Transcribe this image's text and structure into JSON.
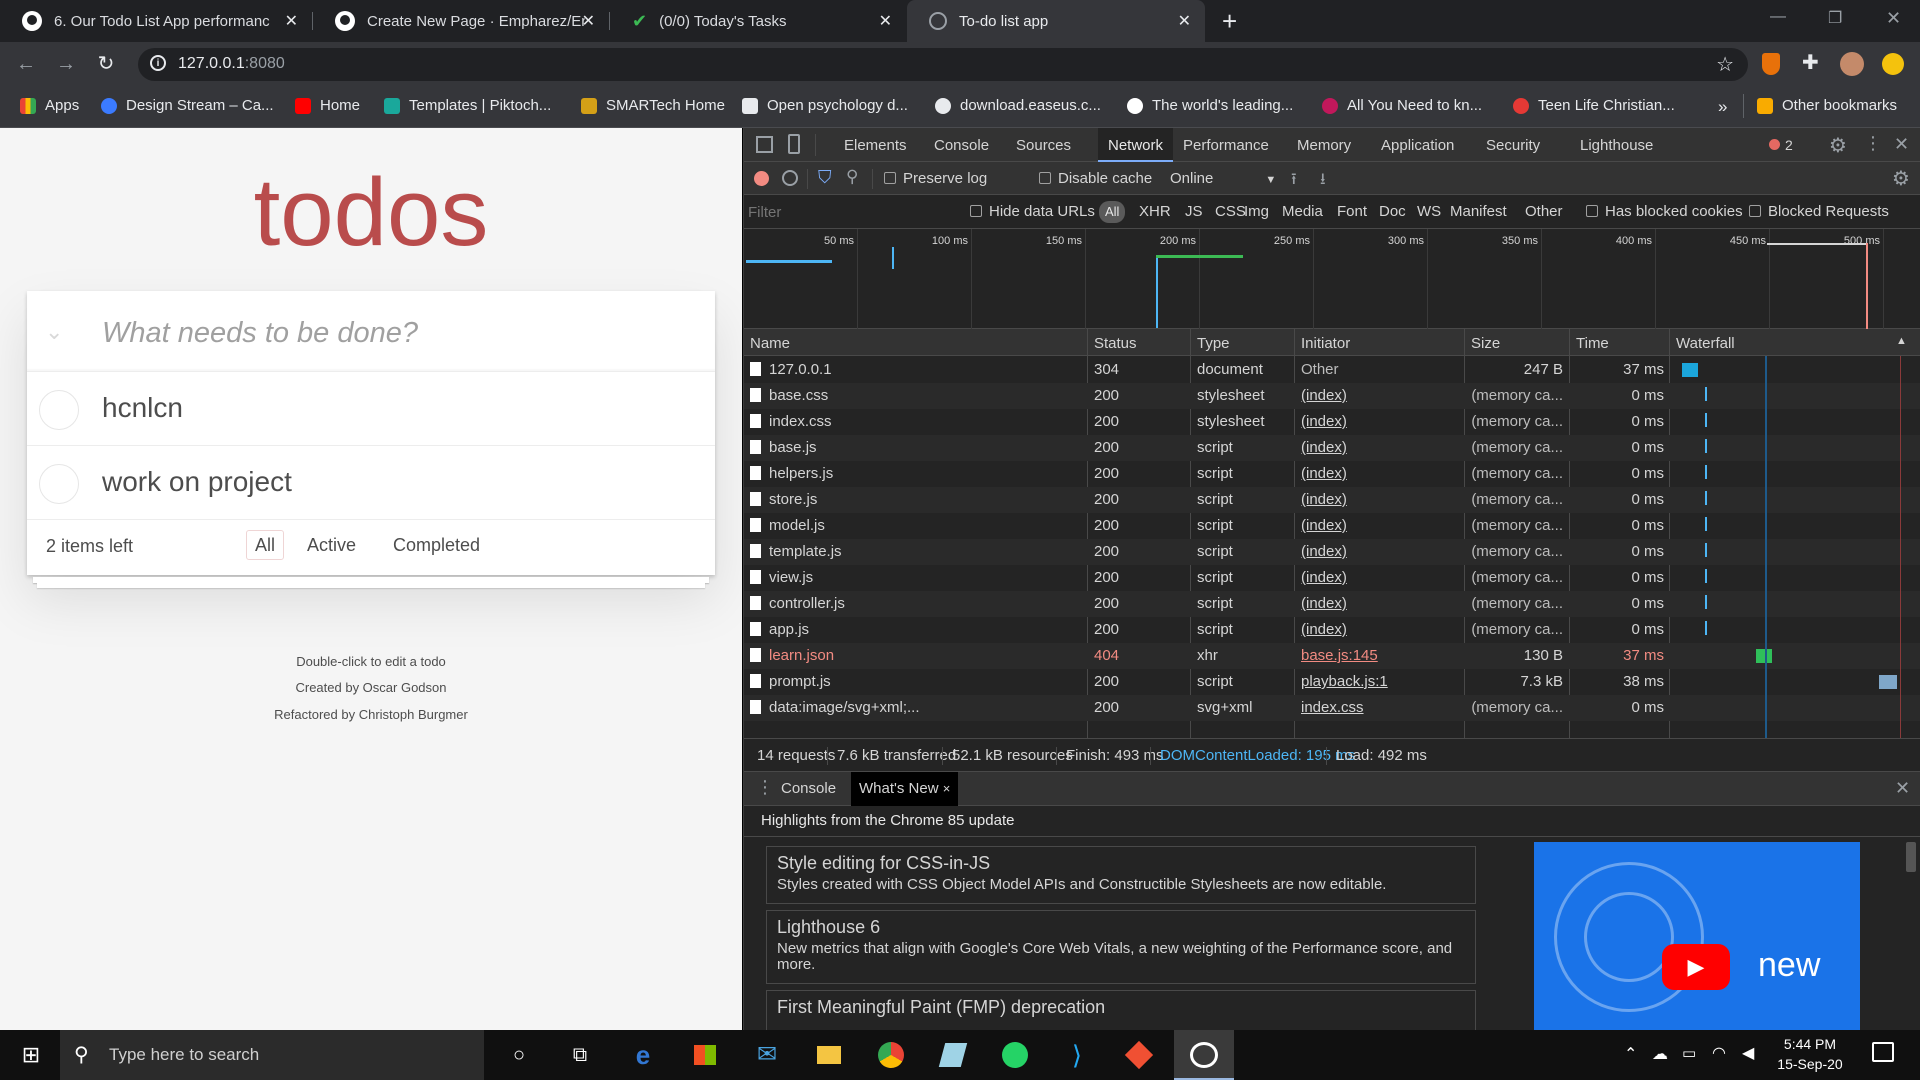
{
  "browser": {
    "tabs": [
      {
        "title": "6. Our Todo List App performanc",
        "icon": "github-icon"
      },
      {
        "title": "Create New Page · Empharez/Enh",
        "icon": "github-icon"
      },
      {
        "title": "(0/0) Today's Tasks",
        "icon": "check-icon"
      },
      {
        "title": "To-do list app",
        "icon": "globe-icon"
      }
    ],
    "new_tab": "+",
    "url_host": "127.0.0.1",
    "url_port": ":8080",
    "bookmarks": [
      "Apps",
      "Design Stream – Ca...",
      "Home",
      "Templates | Piktoch...",
      "SMARTech Home",
      "Open psychology d...",
      "download.easeus.c...",
      "The world's leading...",
      "All You Need to kn...",
      "Teen Life Christian..."
    ],
    "bookmarks_more": "»",
    "other_bookmarks": "Other bookmarks"
  },
  "todo": {
    "title": "todos",
    "placeholder": "What needs to be done?",
    "items": [
      "hcnlcn",
      "work on project"
    ],
    "items_left": "2 items left",
    "filters": [
      "All",
      "Active",
      "Completed"
    ],
    "info": [
      "Double-click to edit a todo",
      "Created by Oscar Godson",
      "Refactored by Christoph Burgmer"
    ]
  },
  "devtools": {
    "tabs": [
      "Elements",
      "Console",
      "Sources",
      "Network",
      "Performance",
      "Memory",
      "Application",
      "Security",
      "Lighthouse"
    ],
    "error_count": "2",
    "toolbar": {
      "preserve_log": "Preserve log",
      "disable_cache": "Disable cache",
      "throttle": "Online"
    },
    "filter": {
      "placeholder": "Filter",
      "hide_data_urls": "Hide data URLs",
      "types": [
        "All",
        "XHR",
        "JS",
        "CSS",
        "Img",
        "Media",
        "Font",
        "Doc",
        "WS",
        "Manifest",
        "Other"
      ],
      "has_blocked_cookies": "Has blocked cookies",
      "blocked_requests": "Blocked Requests"
    },
    "overview_ticks": [
      "50 ms",
      "100 ms",
      "150 ms",
      "200 ms",
      "250 ms",
      "300 ms",
      "350 ms",
      "400 ms",
      "450 ms",
      "500 ms"
    ],
    "columns": [
      "Name",
      "Status",
      "Type",
      "Initiator",
      "Size",
      "Time",
      "Waterfall"
    ],
    "requests": [
      {
        "name": "127.0.0.1",
        "status": "304",
        "type": "document",
        "initiator": "Other",
        "size": "247 B",
        "time": "37 ms",
        "error": false,
        "link": false
      },
      {
        "name": "base.css",
        "status": "200",
        "type": "stylesheet",
        "initiator": "(index)",
        "size": "(memory ca...",
        "time": "0 ms",
        "error": false,
        "link": true
      },
      {
        "name": "index.css",
        "status": "200",
        "type": "stylesheet",
        "initiator": "(index)",
        "size": "(memory ca...",
        "time": "0 ms",
        "error": false,
        "link": true
      },
      {
        "name": "base.js",
        "status": "200",
        "type": "script",
        "initiator": "(index)",
        "size": "(memory ca...",
        "time": "0 ms",
        "error": false,
        "link": true
      },
      {
        "name": "helpers.js",
        "status": "200",
        "type": "script",
        "initiator": "(index)",
        "size": "(memory ca...",
        "time": "0 ms",
        "error": false,
        "link": true
      },
      {
        "name": "store.js",
        "status": "200",
        "type": "script",
        "initiator": "(index)",
        "size": "(memory ca...",
        "time": "0 ms",
        "error": false,
        "link": true
      },
      {
        "name": "model.js",
        "status": "200",
        "type": "script",
        "initiator": "(index)",
        "size": "(memory ca...",
        "time": "0 ms",
        "error": false,
        "link": true
      },
      {
        "name": "template.js",
        "status": "200",
        "type": "script",
        "initiator": "(index)",
        "size": "(memory ca...",
        "time": "0 ms",
        "error": false,
        "link": true
      },
      {
        "name": "view.js",
        "status": "200",
        "type": "script",
        "initiator": "(index)",
        "size": "(memory ca...",
        "time": "0 ms",
        "error": false,
        "link": true
      },
      {
        "name": "controller.js",
        "status": "200",
        "type": "script",
        "initiator": "(index)",
        "size": "(memory ca...",
        "time": "0 ms",
        "error": false,
        "link": true
      },
      {
        "name": "app.js",
        "status": "200",
        "type": "script",
        "initiator": "(index)",
        "size": "(memory ca...",
        "time": "0 ms",
        "error": false,
        "link": true
      },
      {
        "name": "learn.json",
        "status": "404",
        "type": "xhr",
        "initiator": "base.js:145",
        "size": "130 B",
        "time": "37 ms",
        "error": true,
        "link": true
      },
      {
        "name": "prompt.js",
        "status": "200",
        "type": "script",
        "initiator": "playback.js:1",
        "size": "7.3 kB",
        "time": "38 ms",
        "error": false,
        "link": true
      },
      {
        "name": "data:image/svg+xml;...",
        "status": "200",
        "type": "svg+xml",
        "initiator": "index.css",
        "size": "(memory ca...",
        "time": "0 ms",
        "error": false,
        "link": true
      }
    ],
    "summary": {
      "requests": "14 requests",
      "transferred": "7.6 kB transferred",
      "resources": "52.1 kB resources",
      "finish": "Finish: 493 ms",
      "dcl": "DOMContentLoaded: 195 ms",
      "load": "Load: 492 ms"
    },
    "drawer": {
      "tabs": [
        "Console",
        "What's New"
      ],
      "close_x": "×",
      "highlights": "Highlights from the Chrome 85 update",
      "cards": [
        {
          "title": "Style editing for CSS-in-JS",
          "desc": "Styles created with CSS Object Model APIs and Constructible Stylesheets are now editable."
        },
        {
          "title": "Lighthouse 6",
          "desc": "New metrics that align with Google's Core Web Vitals, a new weighting of the Performance score, and more."
        },
        {
          "title": "First Meaningful Paint (FMP) deprecation",
          "desc": ""
        }
      ],
      "promo_label": "new"
    },
    "colors": {
      "accent": "#7cacf8",
      "record": "#f28b82",
      "dcl": "#4db6f5",
      "error": "#f28b82"
    }
  },
  "taskbar": {
    "search_placeholder": "Type here to search",
    "time": "5:44 PM",
    "date": "15-Sep-20"
  }
}
